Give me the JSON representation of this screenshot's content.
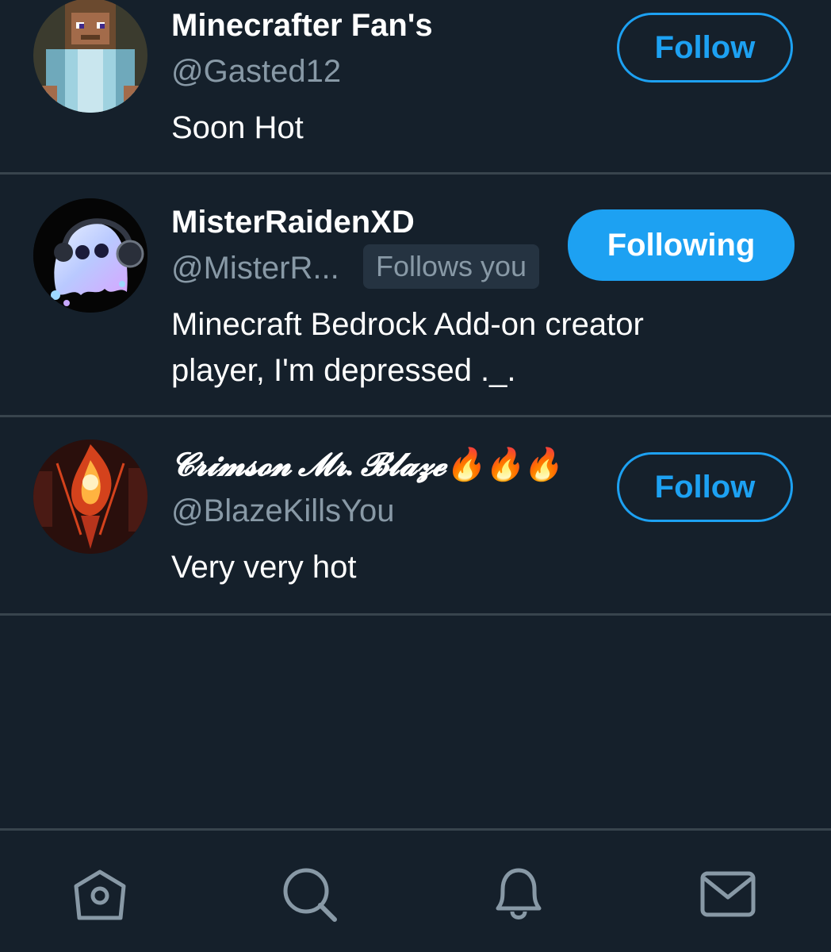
{
  "users": [
    {
      "name": "Minecrafter Fan's",
      "handle": "@Gasted12",
      "bio_lines": [
        "Soon Hot"
      ],
      "button_label": "Follow",
      "follows_you": null
    },
    {
      "name": "MisterRaidenXD",
      "handle": "@MisterR...",
      "bio_lines": [
        "Minecraft Bedrock Add-on creator",
        "player, I'm depressed ._."
      ],
      "button_label": "Following",
      "follows_you": "Follows you"
    },
    {
      "name": "𝓒𝓻𝓲𝓶𝓼𝓸𝓷 𝓜𝓻. 𝓑𝓵𝓪𝔃𝓮🔥🔥🔥",
      "handle": "@BlazeKillsYou",
      "bio_lines": [
        "Very very hot"
      ],
      "button_label": "Follow",
      "follows_you": null
    }
  ],
  "tabbar": {
    "items": [
      {
        "icon": "home-icon"
      },
      {
        "icon": "search-icon"
      },
      {
        "icon": "notifications-bell-icon"
      },
      {
        "icon": "messages-mail-icon"
      }
    ]
  },
  "colors": {
    "background": "#15202b",
    "divider": "#38444d",
    "accent": "#1da1f2",
    "secondary_text": "#8899a6",
    "badge_bg": "#253341"
  }
}
